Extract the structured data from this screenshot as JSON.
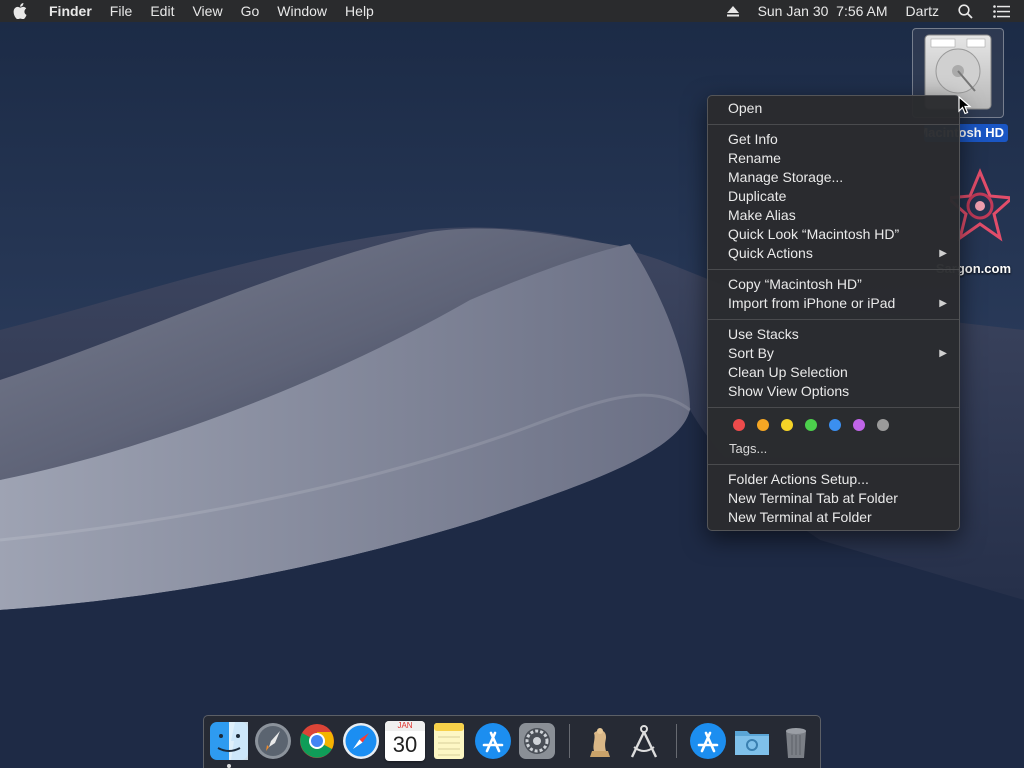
{
  "menubar": {
    "app_name": "Finder",
    "menus": [
      "File",
      "Edit",
      "View",
      "Go",
      "Window",
      "Help"
    ],
    "datetime": "Sun Jan 30  7:56 AM",
    "user": "Dartz"
  },
  "desktop": {
    "hd_label": "Macintosh HD",
    "site_label": "Sargon.com"
  },
  "context_menu": {
    "open": "Open",
    "get_info": "Get Info",
    "rename": "Rename",
    "manage_storage": "Manage Storage...",
    "duplicate": "Duplicate",
    "make_alias": "Make Alias",
    "quick_look": "Quick Look “Macintosh HD”",
    "quick_actions": "Quick Actions",
    "copy": "Copy “Macintosh HD”",
    "import_iphone": "Import from iPhone or iPad",
    "use_stacks": "Use Stacks",
    "sort_by": "Sort By",
    "clean_up": "Clean Up Selection",
    "show_view_options": "Show View Options",
    "tags": "Tags...",
    "folder_actions": "Folder Actions Setup...",
    "new_terminal_tab": "New Terminal Tab at Folder",
    "new_terminal": "New Terminal at Folder",
    "tag_colors": [
      "#ee4b4b",
      "#f5a623",
      "#f5d327",
      "#4ccf4c",
      "#3b8ff0",
      "#c065e8",
      "#9a9a9a"
    ]
  },
  "dock": {
    "calendar_month": "JAN",
    "calendar_day": "30"
  }
}
